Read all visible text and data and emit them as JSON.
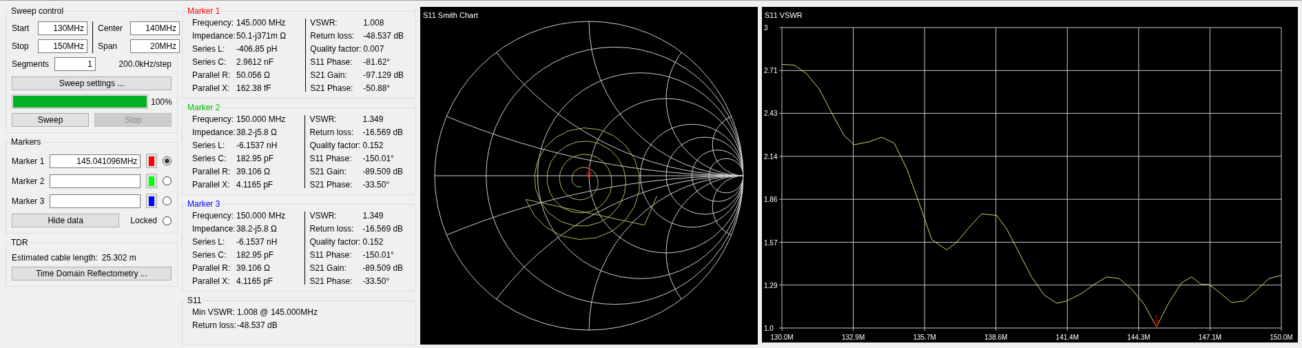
{
  "sweep_control": {
    "title": "Sweep control",
    "fields": [
      {
        "label": "Start",
        "value": "130MHz"
      },
      {
        "label": "Center",
        "value": "140MHz"
      },
      {
        "label": "Stop",
        "value": "150MHz"
      },
      {
        "label": "Span",
        "value": "20MHz"
      }
    ],
    "segments": {
      "label": "Segments",
      "value": "1"
    },
    "step": "200.0kHz/step",
    "settings_button": "Sweep settings ...",
    "progress": {
      "level": 1.0,
      "reading": "100%"
    },
    "buttons": [
      {
        "label": "Sweep",
        "disabled": false
      },
      {
        "label": "Stop",
        "disabled": true
      }
    ]
  },
  "markers": {
    "title": "Markers",
    "items": [
      {
        "label": "Marker 1",
        "value": "145.041096MHz",
        "color": "#ff0000",
        "selected": true
      },
      {
        "label": "Marker 2",
        "color": "#00ff00",
        "selected": false
      },
      {
        "label": "Marker 3",
        "color": "#0000ff",
        "selected": false
      }
    ],
    "hide_button": "Hide data",
    "locked": {
      "label": "Locked",
      "checked": false
    }
  },
  "tdr": {
    "title": "TDR",
    "cable_length": {
      "label": "Estimated cable length:",
      "value": "25.302 m"
    },
    "button": "Time Domain Reflectometry ..."
  },
  "marker_data": [
    {
      "title": "Marker 1",
      "color": "#ff0000",
      "left": [
        {
          "label": "Frequency:",
          "value": "145.000 MHz"
        },
        {
          "label": "Impedance:",
          "value": "50.1-j371m Ω"
        },
        {
          "label": "Series L:",
          "value": "-406.85 pH"
        },
        {
          "label": "Series C:",
          "value": "2.9612 nF"
        },
        {
          "label": "Parallel R:",
          "value": "50.056 Ω"
        },
        {
          "label": "Parallel X:",
          "value": "162.38 fF"
        }
      ],
      "right": [
        {
          "label": "VSWR:",
          "value": "1.008"
        },
        {
          "label": "Return loss:",
          "value": "-48.537 dB"
        },
        {
          "label": "Quality factor:",
          "value": "0.007"
        },
        {
          "label": "S11 Phase:",
          "value": "-81.62°"
        },
        {
          "label": "S21 Gain:",
          "value": "-97.129 dB"
        },
        {
          "label": "S21 Phase:",
          "value": "-50.88°"
        }
      ]
    },
    {
      "title": "Marker 2",
      "color": "#00bb00",
      "left": [
        {
          "label": "Frequency:",
          "value": "150.000 MHz"
        },
        {
          "label": "Impedance:",
          "value": "38.2-j5.8 Ω"
        },
        {
          "label": "Series L:",
          "value": "-6.1537 nH"
        },
        {
          "label": "Series C:",
          "value": "182.95 pF"
        },
        {
          "label": "Parallel R:",
          "value": "39.106 Ω"
        },
        {
          "label": "Parallel X:",
          "value": "4.1165 pF"
        }
      ],
      "right": [
        {
          "label": "VSWR:",
          "value": "1.349"
        },
        {
          "label": "Return loss:",
          "value": "-16.569 dB"
        },
        {
          "label": "Quality factor:",
          "value": "0.152"
        },
        {
          "label": "S11 Phase:",
          "value": "-150.01°"
        },
        {
          "label": "S21 Gain:",
          "value": "-89.509 dB"
        },
        {
          "label": "S21 Phase:",
          "value": "-33.50°"
        }
      ]
    },
    {
      "title": "Marker 3",
      "color": "#0000ff",
      "left": [
        {
          "label": "Frequency:",
          "value": "150.000 MHz"
        },
        {
          "label": "Impedance:",
          "value": "38.2-j5.8 Ω"
        },
        {
          "label": "Series L:",
          "value": "-6.1537 nH"
        },
        {
          "label": "Series C:",
          "value": "182.95 pF"
        },
        {
          "label": "Parallel R:",
          "value": "39.106 Ω"
        },
        {
          "label": "Parallel X:",
          "value": "4.1165 pF"
        }
      ],
      "right": [
        {
          "label": "VSWR:",
          "value": "1.349"
        },
        {
          "label": "Return loss:",
          "value": "-16.569 dB"
        },
        {
          "label": "Quality factor:",
          "value": "0.152"
        },
        {
          "label": "S11 Phase:",
          "value": "-150.01°"
        },
        {
          "label": "S21 Gain:",
          "value": "-89.509 dB"
        },
        {
          "label": "S21 Phase:",
          "value": "-33.50°"
        }
      ]
    }
  ],
  "s11": {
    "title": "S11",
    "rows": [
      {
        "label": "Min VSWR:",
        "value": "1.008 @ 145.000MHz"
      },
      {
        "label": "Return loss:",
        "value": "-48.537 dB"
      }
    ]
  },
  "smith_chart": {
    "title": "S11 Smith Chart",
    "marker_label": "1"
  },
  "vswr_chart": {
    "title": "S11 VSWR",
    "chart_data": {
      "type": "line",
      "x": [
        130,
        130.5,
        131,
        131.5,
        132,
        132.5,
        132.9,
        133.5,
        134,
        134.5,
        135,
        135.5,
        136,
        136.6,
        137,
        137.5,
        138,
        138.6,
        139,
        139.5,
        140,
        140.5,
        141,
        141.4,
        142,
        142.5,
        143,
        143.5,
        144,
        144.5,
        145,
        145.5,
        146,
        146.4,
        146.8,
        147.1,
        147.5,
        148,
        148.5,
        149,
        149.5,
        150
      ],
      "grid": true,
      "series": [
        {
          "color": "#d8d86a",
          "values": [
            2.755,
            2.75,
            2.69,
            2.59,
            2.43,
            2.28,
            2.22,
            2.24,
            2.27,
            2.23,
            2.06,
            1.83,
            1.59,
            1.52,
            1.57,
            1.67,
            1.76,
            1.75,
            1.66,
            1.5,
            1.34,
            1.22,
            1.165,
            1.18,
            1.23,
            1.29,
            1.34,
            1.33,
            1.26,
            1.16,
            1.008,
            1.17,
            1.3,
            1.34,
            1.29,
            1.29,
            1.24,
            1.17,
            1.18,
            1.25,
            1.33,
            1.35
          ]
        }
      ],
      "xlim": [
        130,
        150
      ],
      "ylim": [
        1,
        3
      ],
      "xticks": [
        {
          "value": 130,
          "label": "130.0M"
        },
        {
          "value": 132.857,
          "label": "132.9M"
        },
        {
          "value": 135.714,
          "label": "135.7M"
        },
        {
          "value": 138.571,
          "label": "138.6M"
        },
        {
          "value": 141.429,
          "label": "141.4M"
        },
        {
          "value": 144.286,
          "label": "144.3M"
        },
        {
          "value": 147.143,
          "label": "147.1M"
        },
        {
          "value": 150,
          "label": "150.0M"
        }
      ],
      "yticks": [
        {
          "value": 1,
          "label": "1.0"
        },
        {
          "value": 1.286,
          "label": "1.29"
        },
        {
          "value": 1.571,
          "label": "1.57"
        },
        {
          "value": 1.857,
          "label": "1.86"
        },
        {
          "value": 2.143,
          "label": "2.14"
        },
        {
          "value": 2.429,
          "label": "2.43"
        },
        {
          "value": 2.714,
          "label": "2.71"
        },
        {
          "value": 3,
          "label": "3"
        }
      ],
      "annotations": [
        {
          "text": "1",
          "x": 145,
          "y": 1.008
        }
      ]
    }
  }
}
